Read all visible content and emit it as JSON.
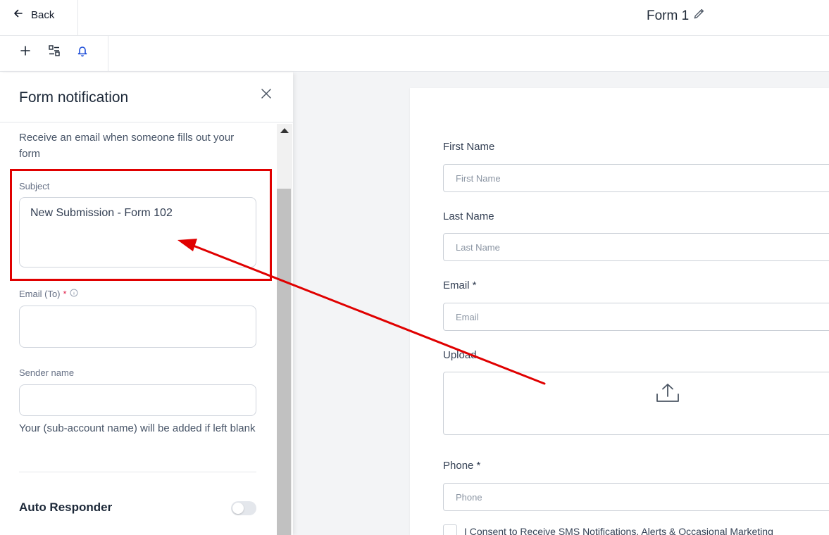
{
  "topbar": {
    "back_label": "Back",
    "form_title": "Form 1"
  },
  "toolbar": {
    "icons": [
      "plus-icon",
      "layout-icon",
      "bell-icon"
    ]
  },
  "panel": {
    "title": "Form notification",
    "description": "Receive an email when someone fills out your form",
    "subject_label": "Subject",
    "subject_value": "New Submission - Form 102",
    "email_label": "Email (To)",
    "email_required": "*",
    "email_value": "",
    "sender_label": "Sender name",
    "sender_value": "",
    "sender_help": "Your (sub-account name) will be added if left blank",
    "auto_responder_label": "Auto Responder",
    "auto_responder_enabled": false
  },
  "form": {
    "fields": [
      {
        "label": "First Name",
        "placeholder": "First Name"
      },
      {
        "label": "Last Name",
        "placeholder": "Last Name"
      },
      {
        "label": "Email *",
        "placeholder": "Email"
      },
      {
        "label": "Upload"
      },
      {
        "label": "Phone *",
        "placeholder": "Phone"
      }
    ],
    "consent_text": "I Consent to Receive SMS Notifications, Alerts & Occasional Marketing"
  },
  "colors": {
    "annotation_red": "#e00000",
    "accent_blue": "#1d4ed8",
    "required_red": "#e11d48"
  }
}
